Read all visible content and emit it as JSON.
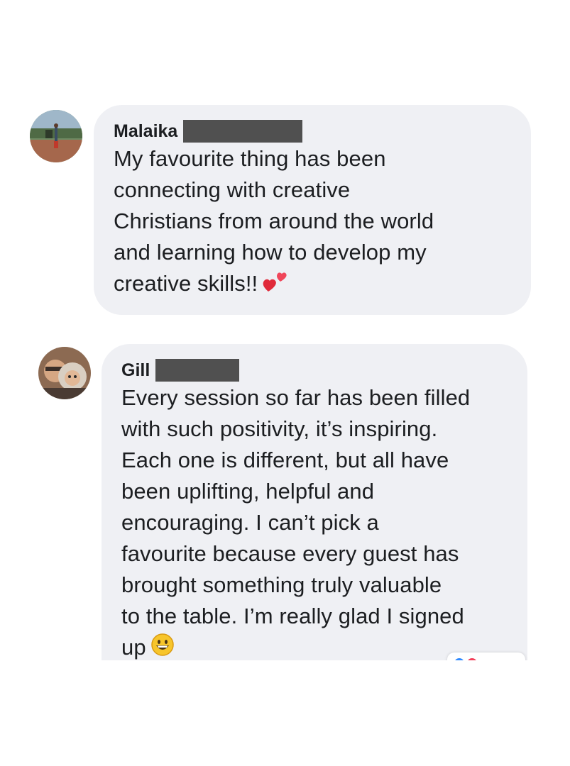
{
  "comments": [
    {
      "author": "Malaika",
      "lines": [
        "My favourite thing has been",
        "connecting with creative",
        "Christians from around the world",
        "and learning how to develop my",
        "creative skills!!"
      ],
      "emoji": "two-hearts"
    },
    {
      "author": "Gill",
      "lines": [
        "Every session so far has been filled",
        "with such positivity, it’s inspiring.",
        "Each one is different, but all have",
        "been uplifting, helpful and",
        "encouraging. I can’t pick a",
        "favourite because every guest has",
        "brought something truly valuable",
        "to the table. I’m really glad I signed",
        "up"
      ],
      "emoji": "grinning-face"
    }
  ],
  "colors": {
    "bubble": "#eff0f4",
    "text": "#1c1e21",
    "redaction": "#505050"
  }
}
